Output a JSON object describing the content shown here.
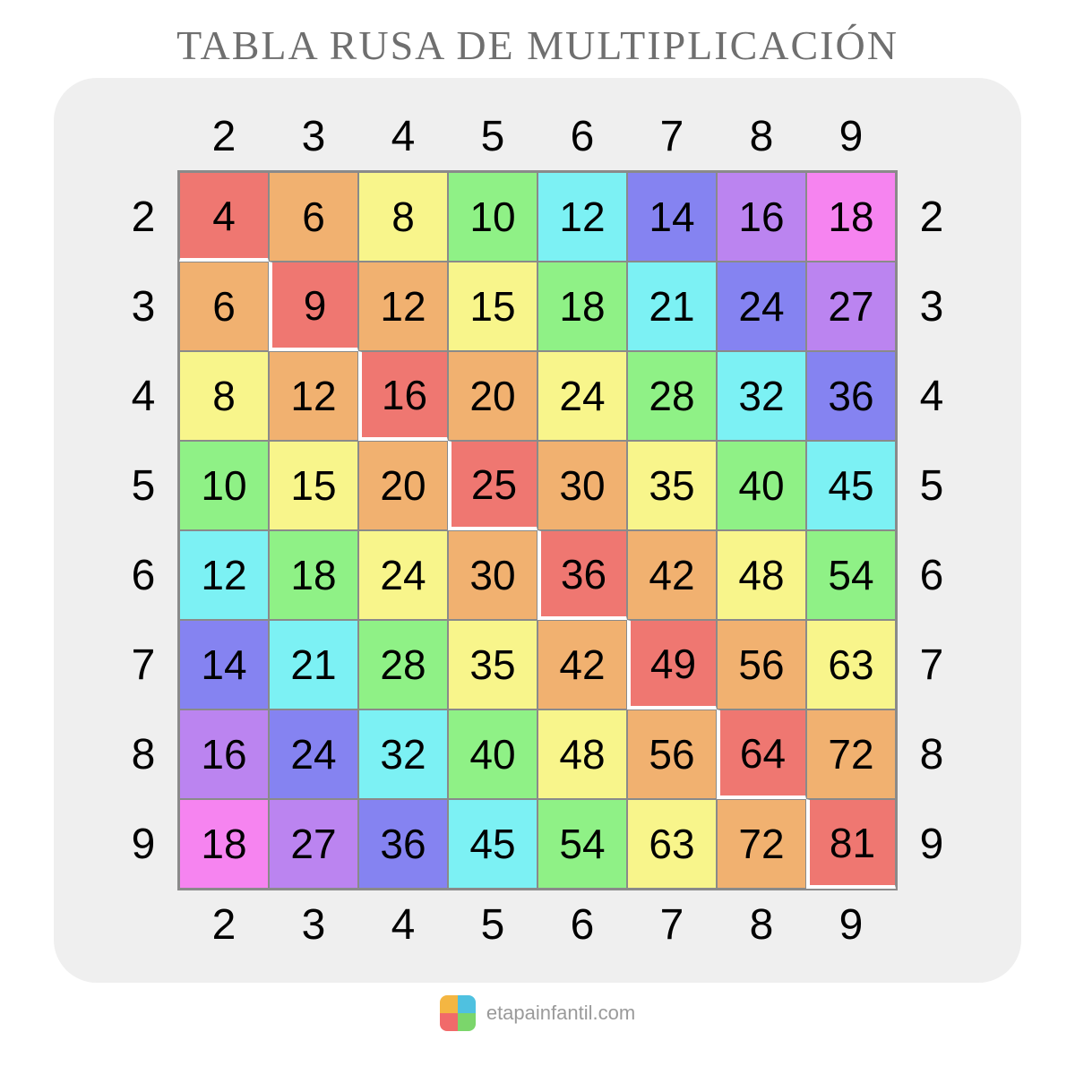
{
  "title": "TABLA RUSA DE MULTIPLICACIÓN",
  "headers": [
    "2",
    "3",
    "4",
    "5",
    "6",
    "7",
    "8",
    "9"
  ],
  "footer": "etapainfantil.com",
  "colors": {
    "0": "#ef7771",
    "1": "#f1b170",
    "2": "#f8f58b",
    "3": "#8ff186",
    "4": "#7cf1f4",
    "5": "#8583f1",
    "6": "#bb84f0",
    "7": "#f684f0"
  },
  "chart_data": {
    "type": "table",
    "title": "TABLA RUSA DE MULTIPLICACIÓN",
    "row_labels": [
      2,
      3,
      4,
      5,
      6,
      7,
      8,
      9
    ],
    "col_labels": [
      2,
      3,
      4,
      5,
      6,
      7,
      8,
      9
    ],
    "cells": [
      [
        4,
        6,
        8,
        10,
        12,
        14,
        16,
        18
      ],
      [
        6,
        9,
        12,
        15,
        18,
        21,
        24,
        27
      ],
      [
        8,
        12,
        16,
        20,
        24,
        28,
        32,
        36
      ],
      [
        10,
        15,
        20,
        25,
        30,
        35,
        40,
        45
      ],
      [
        12,
        18,
        24,
        30,
        36,
        42,
        48,
        54
      ],
      [
        14,
        21,
        28,
        35,
        42,
        49,
        56,
        63
      ],
      [
        16,
        24,
        32,
        40,
        48,
        56,
        64,
        72
      ],
      [
        18,
        27,
        36,
        45,
        54,
        63,
        72,
        81
      ]
    ],
    "cell_color_index": [
      [
        0,
        1,
        2,
        3,
        4,
        5,
        6,
        7
      ],
      [
        1,
        0,
        1,
        2,
        3,
        4,
        5,
        6
      ],
      [
        2,
        1,
        0,
        1,
        2,
        3,
        4,
        5
      ],
      [
        3,
        2,
        1,
        0,
        1,
        2,
        3,
        4
      ],
      [
        4,
        3,
        2,
        1,
        0,
        1,
        2,
        3
      ],
      [
        5,
        4,
        3,
        2,
        1,
        0,
        1,
        2
      ],
      [
        6,
        5,
        4,
        3,
        2,
        1,
        0,
        1
      ],
      [
        7,
        6,
        5,
        4,
        3,
        2,
        1,
        0
      ]
    ]
  }
}
